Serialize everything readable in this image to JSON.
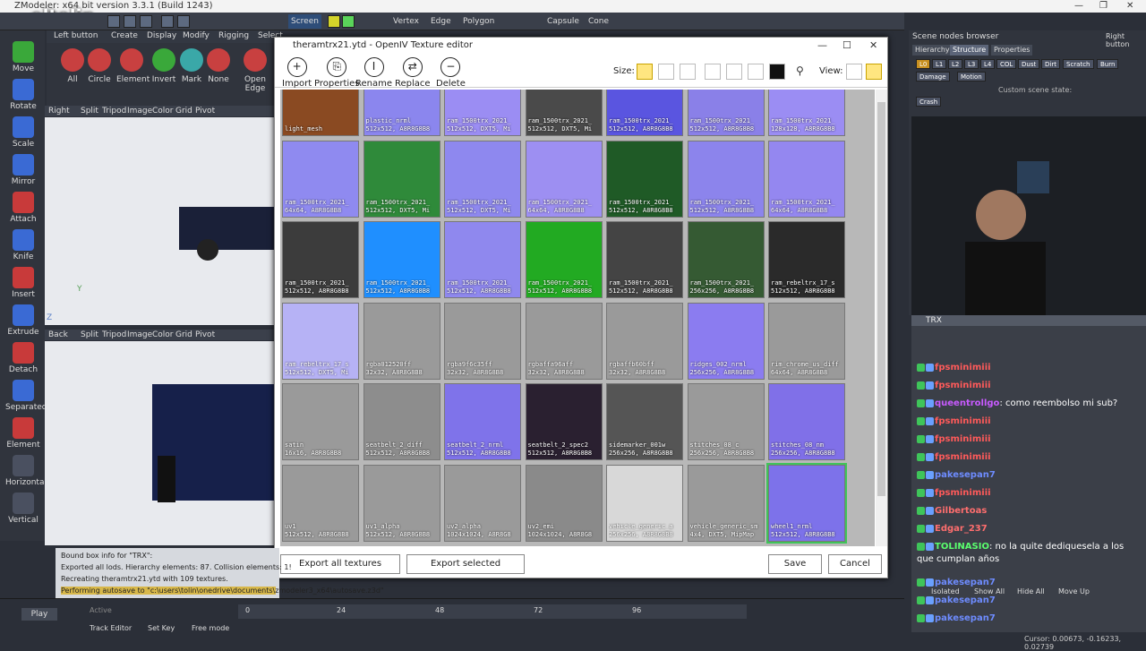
{
  "app": {
    "title": "ZModeler: x64 bit version 3.3.1 (Build 1243)",
    "streamer_logo": "eltolin"
  },
  "toolbar": {
    "screen_label": "Screen",
    "vertex": "Vertex",
    "edge": "Edge",
    "polygon": "Polygon",
    "capsule": "Capsule",
    "cone": "Cone"
  },
  "tabs": {
    "left_button": "Left button",
    "create": "Create",
    "display": "Display",
    "modify": "Modify",
    "rigging": "Rigging",
    "select": "Select"
  },
  "left_tools": [
    "Move",
    "Rotate",
    "Scale",
    "Mirror",
    "Attach",
    "Knife",
    "Insert",
    "Extrude",
    "Detach",
    "Separated",
    "Element",
    "Horizontal",
    "Vertical"
  ],
  "commands": [
    "All",
    "Circle",
    "Element",
    "Invert",
    "Mark",
    "None",
    "Open Edge"
  ],
  "viewport_top": {
    "name": "Right",
    "items": [
      "Split",
      "Tripod",
      "Image",
      "Color",
      "Grid",
      "Pivot"
    ]
  },
  "viewport_bottom": {
    "name": "Back",
    "items": [
      "Split",
      "Tripod",
      "Image",
      "Color",
      "Grid",
      "Pivot"
    ]
  },
  "dialog": {
    "title": "theramtrx21.ytd - OpenIV Texture editor",
    "tools": [
      {
        "label": "Import",
        "icon": "+"
      },
      {
        "label": "Properties",
        "icon": "⎘"
      },
      {
        "label": "Rename",
        "icon": "I"
      },
      {
        "label": "Replace",
        "icon": "⇄"
      },
      {
        "label": "Delete",
        "icon": "−"
      }
    ],
    "size_label": "Size:",
    "view_label": "View:",
    "export_all": "Export all textures",
    "export_selected": "Export selected",
    "save": "Save",
    "cancel": "Cancel",
    "textures": [
      {
        "name": "light_mesh",
        "info": "",
        "color": "#8a4a22"
      },
      {
        "name": "plastic_nrml",
        "info": "512x512, A8R8G8B8",
        "color": "#8b86ee"
      },
      {
        "name": "ram_1500trx_2021_",
        "info": "512x512, DXT5, Mi",
        "color": "#9b8df3"
      },
      {
        "name": "ram_1500trx_2021_",
        "info": "512x512, DXT5, Mi",
        "color": "#4a4a4a"
      },
      {
        "name": "ram_1500trx_2021_",
        "info": "512x512, A8R8G8B8",
        "color": "#5a55e0"
      },
      {
        "name": "ram_1500trx_2021_",
        "info": "512x512, A8R8G8B8",
        "color": "#8a80e8"
      },
      {
        "name": "ram_1500trx_2021_",
        "info": "128x128, A8R8G8B8",
        "color": "#9b8df3"
      },
      {
        "name": "ram_1500trx_2021_",
        "info": "64x64, A8R8G8B8",
        "color": "#8f8af0"
      },
      {
        "name": "ram_1500trx_2021_",
        "info": "512x512, DXT5, Mi",
        "color": "#2f8a3a"
      },
      {
        "name": "ram_1500trx_2021_",
        "info": "512x512, DXT5, Mi",
        "color": "#8e88ef"
      },
      {
        "name": "ram_1500trx_2021_",
        "info": "64x64, A8R8G8B8",
        "color": "#9d8ff2"
      },
      {
        "name": "ram_1500trx_2021_",
        "info": "512x512, A8R8G8B8",
        "color": "#1f5a26"
      },
      {
        "name": "ram_1500trx_2021_",
        "info": "512x512, A8R8G8B8",
        "color": "#8c84ec"
      },
      {
        "name": "ram_1500trx_2021_",
        "info": "64x64, A8R8G8B8",
        "color": "#9487f0"
      },
      {
        "name": "ram_1500trx_2021_",
        "info": "512x512, A8R8G8B8",
        "color": "#3c3c3c"
      },
      {
        "name": "ram_1500trx_2021_",
        "info": "512x512, A8R8G8B8",
        "color": "#1f8fff"
      },
      {
        "name": "ram_1500trx_2021_",
        "info": "512x512, A8R8G8B8",
        "color": "#8f88ee"
      },
      {
        "name": "ram_1500trx_2021_",
        "info": "512x512, A8R8G8B8",
        "color": "#22aa22"
      },
      {
        "name": "ram_1500trx_2021_",
        "info": "512x512, A8R8G8B8",
        "color": "#444"
      },
      {
        "name": "ram_1500trx_2021_",
        "info": "256x256, A8R8G8B8",
        "color": "#355a33"
      },
      {
        "name": "ram_rebeltrx_17_s",
        "info": "512x512, A8R8G8B8",
        "color": "#2a2a2a"
      },
      {
        "name": "ram_rebeltrx_17_s",
        "info": "512x512, DXT5, Mi",
        "color": "#b6b2f5"
      },
      {
        "name": "rgba012520ff",
        "info": "32x32, A8R8G8B8",
        "color": "#9a9a9a"
      },
      {
        "name": "rgba9f6c35ff",
        "info": "32x32, A8R8G8B8",
        "color": "#9a9a9a"
      },
      {
        "name": "rgbaffa96aff",
        "info": "32x32, A8R8G8B8",
        "color": "#9a9a9a"
      },
      {
        "name": "rgbaffb60bff",
        "info": "32x32, A8R8G8B8",
        "color": "#9a9a9a"
      },
      {
        "name": "ridges_002_nrml",
        "info": "256x256, A8R8G8B8",
        "color": "#8b7cf0"
      },
      {
        "name": "rim_chrome_us_diff",
        "info": "64x64, A8R8G8B8",
        "color": "#9a9a9a"
      },
      {
        "name": "satin",
        "info": "16x16, A8R8G8B8",
        "color": "#9a9a9a"
      },
      {
        "name": "seatbelt_2_diff",
        "info": "512x512, A8R8G8B8",
        "color": "#8d8d8d"
      },
      {
        "name": "seatbelt_2_nrml",
        "info": "512x512, A8R8G8B8",
        "color": "#7f73ea"
      },
      {
        "name": "seatbelt_2_spec2",
        "info": "512x512, A8R8G8B8",
        "color": "#2a2030"
      },
      {
        "name": "sidemarker_001w",
        "info": "256x256, A8R8G8B8",
        "color": "#555"
      },
      {
        "name": "stitches_08_c",
        "info": "256x256, A8R8G8B8",
        "color": "#9a9a9a"
      },
      {
        "name": "stitches_08_nm",
        "info": "256x256, A8R8G8B8",
        "color": "#8070e8"
      },
      {
        "name": "uv1",
        "info": "512x512, A8R8G8B8",
        "color": "#9a9a9a"
      },
      {
        "name": "uv1_alpha",
        "info": "512x512, A8R8G8B8",
        "color": "#9a9a9a"
      },
      {
        "name": "uv2_alpha",
        "info": "1024x1024, A8R8G8",
        "color": "#9a9a9a"
      },
      {
        "name": "uv2_emi",
        "info": "1024x1024, A8R8G8",
        "color": "#8a8a8a"
      },
      {
        "name": "vehicle_generic_a",
        "info": "256x256, A8R8G8B8",
        "color": "#d8d8d8"
      },
      {
        "name": "vehicle_generic_sm",
        "info": "4x4, DXT5, MipMap",
        "color": "#9a9a9a"
      },
      {
        "name": "wheel1_nrml",
        "info": "512x512, A8R8G8B8",
        "color": "#7d72ea"
      }
    ]
  },
  "right_panel": {
    "title": "Scene nodes browser",
    "right_button": "Right button",
    "tabs": [
      "Hierarchy",
      "Structure",
      "Properties"
    ],
    "lods": [
      "L0",
      "L1",
      "L2",
      "L3",
      "L4",
      "COL",
      "Dust",
      "Dirt",
      "Scratch",
      "Burn"
    ],
    "damage": "Damage",
    "motion": "Motion",
    "crash": "Crash",
    "custom_state": "Custom scene state:"
  },
  "chat": {
    "title": "TRX",
    "messages": [
      {
        "user": "fpsminimiii",
        "text": "",
        "color": "#ff5a5a"
      },
      {
        "user": "fpsminimiii",
        "text": "",
        "color": "#ff5a5a"
      },
      {
        "user": "queentrollgo",
        "text": ": como reembolso mi sub?",
        "color": "#c85aff"
      },
      {
        "user": "fpsminimiii",
        "text": "",
        "color": "#ff5a5a"
      },
      {
        "user": "fpsminimiii",
        "text": "",
        "color": "#ff5a5a"
      },
      {
        "user": "fpsminimiii",
        "text": "",
        "color": "#ff5a5a"
      },
      {
        "user": "pakesepan7",
        "text": "",
        "color": "#6e8cff"
      },
      {
        "user": "fpsminimiii",
        "text": "",
        "color": "#ff5a5a"
      },
      {
        "user": "Gilbertoas",
        "text": "",
        "color": "#ff6e6e"
      },
      {
        "user": "Edgar_237",
        "text": "",
        "color": "#ff6e6e"
      },
      {
        "user": "TOLINASIO",
        "text": ": no la quite dediquesela a los que cumplan años",
        "color": "#5aff6e"
      },
      {
        "user": "pakesepan7",
        "text": "",
        "color": "#6e8cff"
      },
      {
        "user": "pakesepan7",
        "text": "",
        "color": "#6e8cff"
      },
      {
        "user": "pakesepan7",
        "text": "",
        "color": "#6e8cff"
      }
    ]
  },
  "log": [
    "Bound box info for \"TRX\":",
    "Exported all lods. Hierarchy elements: 87. Collision elements: 1!",
    "Recreating theramtrx21.ytd with 109 textures.",
    "Performing autosave to \"c:\\users\\tolin\\onedrive\\documents\\zmodeler3_x64\\autosave.z3d\""
  ],
  "bottom": {
    "play": "Play",
    "track_editor": "Track Editor",
    "set_key": "Set Key",
    "free_mode": "Free mode",
    "active": "Active",
    "isolated": "Isolated",
    "show_all": "Show All",
    "hide_all": "Hide All",
    "move_up": "Move Up",
    "cursor": "Cursor: 0.00673, -0.16233, 0.02739",
    "timeline": [
      "0",
      "24",
      "48",
      "72",
      "96"
    ]
  }
}
